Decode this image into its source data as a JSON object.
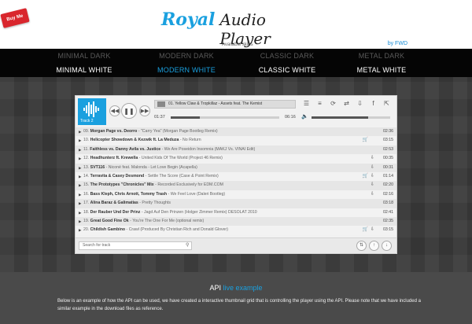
{
  "header": {
    "buy_label": "Buy Me",
    "logo_word1": "Royal",
    "logo_word2": "Audio Player",
    "skins_caption": "Available skins",
    "byline": "by FWD"
  },
  "skins": {
    "top": [
      "MINIMAL DARK",
      "MODERN DARK",
      "CLASSIC DARK",
      "METAL DARK"
    ],
    "bottom": [
      "MINIMAL WHITE",
      "MODERN WHITE",
      "CLASSIC WHITE",
      "METAL WHITE"
    ],
    "active": "MODERN WHITE"
  },
  "player": {
    "thumb_label": "Track 2",
    "now_playing": "01. Yellow Claw & Tropkillaz - Assets feat. The Kemist",
    "elapsed": "01:37",
    "total": "06:16",
    "progress": 0.27,
    "volume": 0.72,
    "search_placeholder": "Search for track",
    "icons": {
      "prev": "prev-icon",
      "play": "pause-icon",
      "next": "next-icon",
      "shuffle": "shuffle-icon",
      "playlist": "playlist-icon",
      "repeat": "repeat-icon",
      "share": "share-icon",
      "download": "download-icon",
      "facebook": "facebook-icon",
      "popup": "popup-icon",
      "volume": "volume-icon"
    },
    "playlist": [
      {
        "num": "09.",
        "artist": "Morgan Page vs. Deorro",
        "title": "\"Carry Yea\" (Morgan Page Bootleg Remix)",
        "duration": "02:36",
        "buy": false,
        "download": false
      },
      {
        "num": "10.",
        "artist": "Helicopter Showdown & Kezwik ft. La Meduza",
        "title": "No Return",
        "duration": "03:15",
        "buy": true,
        "download": false
      },
      {
        "num": "11.",
        "artist": "Faithless vs. Danny Avila vs. Justice",
        "title": "We Are Poseidon Insomnia (MAKJ Vs. VINAI Edit)",
        "duration": "02:53",
        "buy": false,
        "download": false
      },
      {
        "num": "12.",
        "artist": "Headhunterz ft. Krewella",
        "title": "United Kids Of The World (Project 46 Remix)",
        "duration": "00:35",
        "buy": false,
        "download": true
      },
      {
        "num": "13.",
        "artist": "SVT116",
        "title": "Niconé feat. Malonda - Let Love Begin (Acapella)",
        "duration": "00:31",
        "buy": false,
        "download": true
      },
      {
        "num": "14.",
        "artist": "Terravita & Casey Desmond",
        "title": "Settle The Score (Case & Point Remix)",
        "duration": "01:14",
        "buy": true,
        "download": true
      },
      {
        "num": "15.",
        "artist": "The Prototypes \"Chronicles\" Mix",
        "title": "Recorded Exclusively for EDM.COM",
        "duration": "02:20",
        "buy": false,
        "download": true
      },
      {
        "num": "16.",
        "artist": "Bass Kleph, Chris Arnott, Tommy Trash",
        "title": "We Feel Love (Daleri Bootleg)",
        "duration": "02:16",
        "buy": false,
        "download": true
      },
      {
        "num": "17.",
        "artist": "Alina Baraz & Galimatias",
        "title": "Pretty Thoughts",
        "duration": "03:18",
        "buy": false,
        "download": false
      },
      {
        "num": "18.",
        "artist": "Der Rauber Und Der Prinz",
        "title": "Jagd Auf Den Prinzen (Holger Zimmer Remix) DESOLAT 2010",
        "duration": "02:41",
        "buy": false,
        "download": false
      },
      {
        "num": "19.",
        "artist": "Great Good Fine Ok",
        "title": "You're The One For Me (optional remix)",
        "duration": "02:35",
        "buy": false,
        "download": false
      },
      {
        "num": "20.",
        "artist": "Childish Gambino",
        "title": "Crawl (Produced By Christian Rich and Donald Glover)",
        "duration": "03:15",
        "buy": true,
        "download": true
      }
    ]
  },
  "api": {
    "title_prefix": "API",
    "title_link": "live example",
    "description": "Below is an example of how the API can be used, we have created a interactive thumbnail grid that is controlling the player using the API. Please note that we have included a similar example in the download files as reference."
  },
  "colors": {
    "accent": "#1aa0df",
    "buy_red": "#d9262d",
    "nav_bg": "#050505",
    "footer_bg": "#4a4a4a"
  }
}
